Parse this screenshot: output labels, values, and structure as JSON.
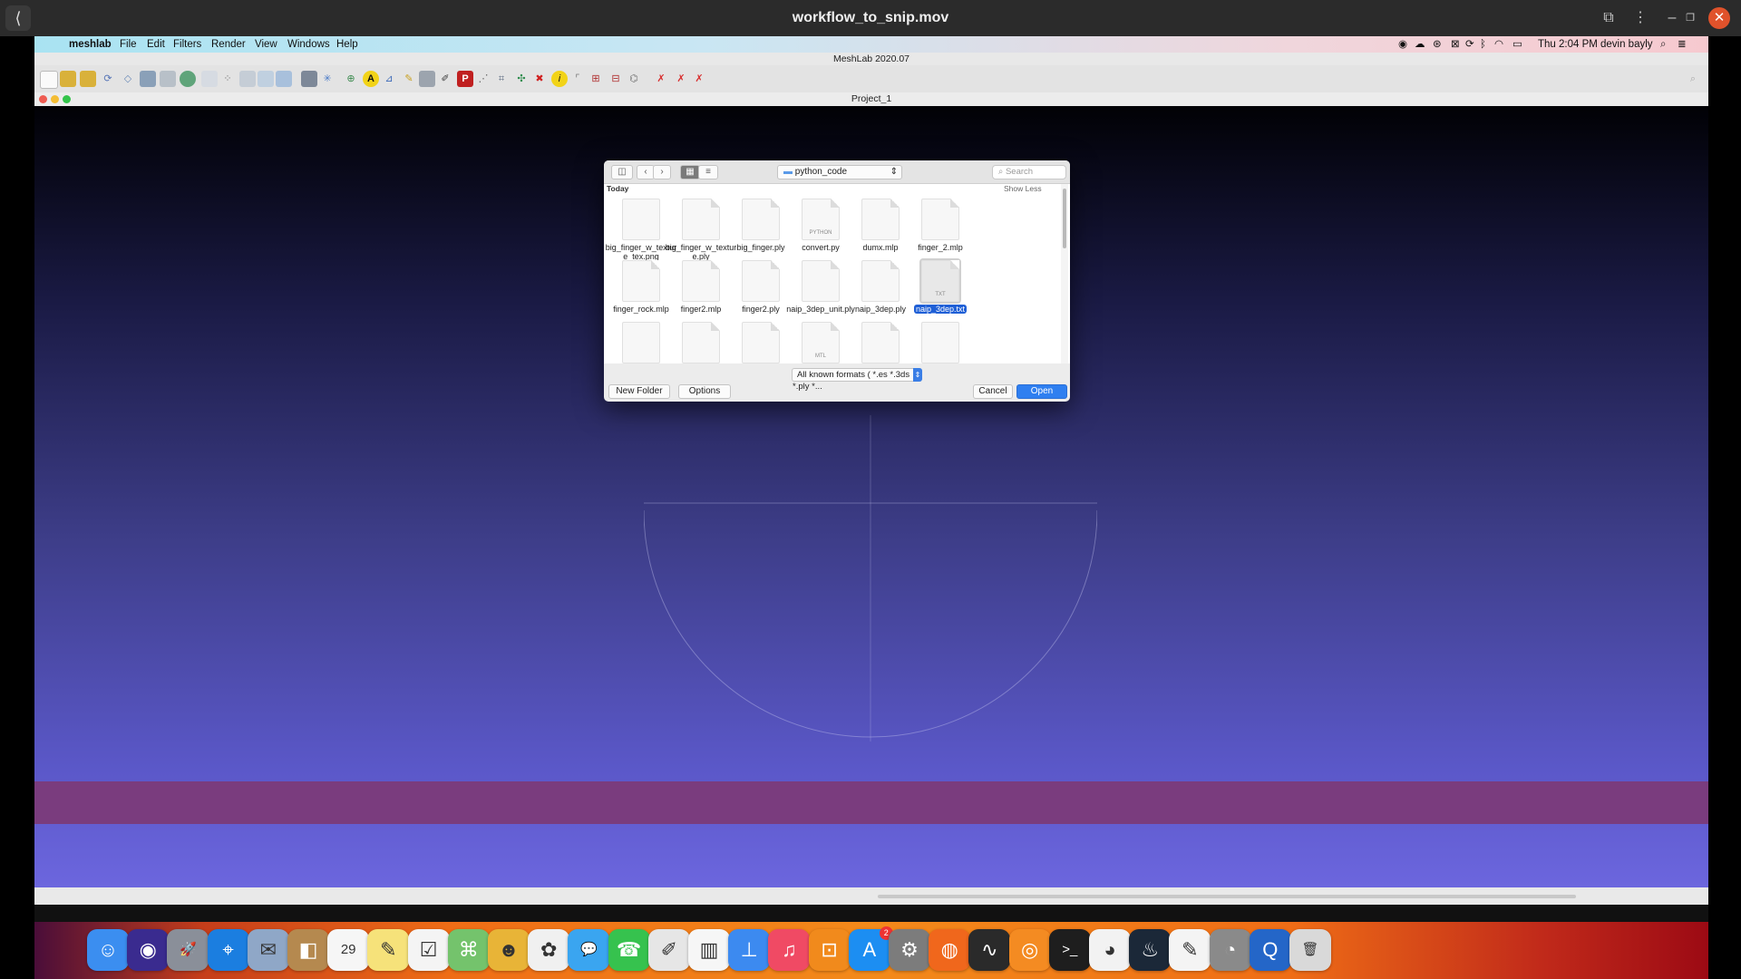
{
  "player": {
    "title": "workflow_to_snip.mov",
    "back_label": "⟨",
    "close_label": "✕"
  },
  "menubar": {
    "apple": "",
    "app_name": "meshlab",
    "items": [
      "File",
      "Edit",
      "Filters",
      "Render",
      "View",
      "Windows",
      "Help"
    ],
    "clock": "Thu 2:04 PM",
    "user": "devin bayly"
  },
  "app": {
    "title": "MeshLab 2020.07",
    "document_title": "Project_1"
  },
  "dialog": {
    "location": "python_code",
    "search_placeholder": "Search",
    "section_label": "Today",
    "show_less_label": "Show Less",
    "files": [
      {
        "name": "big_finger_w_texture_tex.png",
        "kind": "png"
      },
      {
        "name": "big_finger_w_texture.ply",
        "kind": "doc"
      },
      {
        "name": "big_finger.ply",
        "kind": "doc"
      },
      {
        "name": "convert.py",
        "kind": "python",
        "badge": "PYTHON"
      },
      {
        "name": "dumx.mlp",
        "kind": "doc"
      },
      {
        "name": "finger_2.mlp",
        "kind": "doc"
      },
      {
        "name": "finger_rock.mlp",
        "kind": "doc"
      },
      {
        "name": "finger2.mlp",
        "kind": "doc"
      },
      {
        "name": "finger2.ply",
        "kind": "doc"
      },
      {
        "name": "naip_3dep_unit.ply",
        "kind": "doc"
      },
      {
        "name": "naip_3dep.ply",
        "kind": "doc"
      },
      {
        "name": "naip_3dep.txt",
        "kind": "txt",
        "badge": "TXT",
        "selected": true
      },
      {
        "name": "",
        "kind": "image"
      },
      {
        "name": "",
        "kind": "doc"
      },
      {
        "name": "",
        "kind": "doc"
      },
      {
        "name": "",
        "kind": "mtl",
        "badge": "MTL"
      },
      {
        "name": "",
        "kind": "doc"
      },
      {
        "name": "",
        "kind": "image"
      }
    ],
    "format_filter": "All known formats ( *.es *.3ds *.ply *...",
    "new_folder_label": "New Folder",
    "options_label": "Options",
    "cancel_label": "Cancel",
    "open_label": "Open"
  },
  "dock": {
    "apps": [
      {
        "name": "Finder",
        "glyph": "☺",
        "color": "#3b8ef0"
      },
      {
        "name": "Siri",
        "glyph": "◉",
        "color": "#3a2b8f"
      },
      {
        "name": "Launchpad",
        "glyph": "🚀",
        "color": "#8a8f99"
      },
      {
        "name": "Safari",
        "glyph": "⌖",
        "color": "#1b7ee0"
      },
      {
        "name": "Mail Bird",
        "glyph": "✉",
        "color": "#8fa7c7"
      },
      {
        "name": "Contacts",
        "glyph": "◧",
        "color": "#b5894f"
      },
      {
        "name": "Calendar",
        "glyph": "29",
        "color": "#f6f6f6"
      },
      {
        "name": "Notes",
        "glyph": "✎",
        "color": "#f6e27a"
      },
      {
        "name": "Reminders",
        "glyph": "☑",
        "color": "#f4f4f4"
      },
      {
        "name": "Maps",
        "glyph": "⌘",
        "color": "#74c36c"
      },
      {
        "name": "Photo Booth",
        "glyph": "☻",
        "color": "#e8b437"
      },
      {
        "name": "Photos",
        "glyph": "✿",
        "color": "#f0f0f0"
      },
      {
        "name": "Messages",
        "glyph": "💬",
        "color": "#3aa5f0"
      },
      {
        "name": "FaceTime",
        "glyph": "☎",
        "color": "#36c24e"
      },
      {
        "name": "Keynote News",
        "glyph": "✐",
        "color": "#e6e6e6"
      },
      {
        "name": "Numbers",
        "glyph": "▥",
        "color": "#f6f6f6"
      },
      {
        "name": "Keynote",
        "glyph": "⊥",
        "color": "#3c8af0"
      },
      {
        "name": "Music",
        "glyph": "♫",
        "color": "#f04a64"
      },
      {
        "name": "Books",
        "glyph": "⊡",
        "color": "#f18a1c"
      },
      {
        "name": "App Store",
        "glyph": "A",
        "color": "#1c8ef2",
        "badge": "2"
      },
      {
        "name": "System Preferences",
        "glyph": "⚙",
        "color": "#7c7c7c"
      },
      {
        "name": "Firefox",
        "glyph": "◍",
        "color": "#f0671c"
      },
      {
        "name": "Activity Monitor",
        "glyph": "∿",
        "color": "#2a2a2a"
      },
      {
        "name": "Blender",
        "glyph": "◎",
        "color": "#f48b22"
      },
      {
        "name": "Terminal",
        "glyph": ">_",
        "color": "#1e1e1e"
      },
      {
        "name": "Chrome",
        "glyph": "◕",
        "color": "#f2f2f2"
      },
      {
        "name": "Steam",
        "glyph": "♨",
        "color": "#1b2838"
      },
      {
        "name": "TextEdit",
        "glyph": "✎",
        "color": "#f4f4f4"
      },
      {
        "name": "Preview",
        "glyph": "◔",
        "color": "#8a8a8a"
      },
      {
        "name": "QuickTime",
        "glyph": "Q",
        "color": "#2466c8"
      },
      {
        "name": "Trash",
        "glyph": "🗑",
        "color": "#d9d9d9"
      }
    ]
  }
}
